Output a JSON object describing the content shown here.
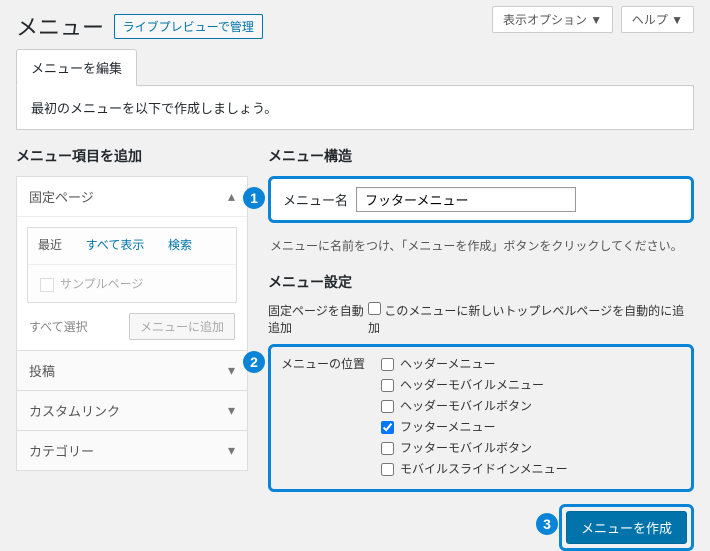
{
  "top": {
    "display_options": "表示オプション ▼",
    "help": "ヘルプ ▼"
  },
  "page": {
    "title": "メニュー",
    "live_preview": "ライブプレビューで管理"
  },
  "tab": {
    "edit": "メニューを編集"
  },
  "notice": "最初のメニューを以下で作成しましょう。",
  "left": {
    "heading": "メニュー項目を追加",
    "pages": {
      "title": "固定ページ",
      "tabs": {
        "recent": "最近",
        "all": "すべて表示",
        "search": "検索"
      },
      "item": "サンプルページ",
      "select_all": "すべて選択",
      "add": "メニューに追加"
    },
    "posts": "投稿",
    "custom": "カスタムリンク",
    "category": "カテゴリー"
  },
  "right": {
    "heading": "メニュー構造",
    "menu_name_label": "メニュー名",
    "menu_name_value": "フッターメニュー",
    "help": "メニューに名前をつけ、「メニューを作成」ボタンをクリックしてください。",
    "settings_heading": "メニュー設定",
    "auto_add_label": "固定ページを自動追加",
    "auto_add_text": "このメニューに新しいトップレベルページを自動的に追加",
    "location_label": "メニューの位置",
    "locations": [
      {
        "label": "ヘッダーメニュー",
        "checked": false
      },
      {
        "label": "ヘッダーモバイルメニュー",
        "checked": false
      },
      {
        "label": "ヘッダーモバイルボタン",
        "checked": false
      },
      {
        "label": "フッターメニュー",
        "checked": true
      },
      {
        "label": "フッターモバイルボタン",
        "checked": false
      },
      {
        "label": "モバイルスライドインメニュー",
        "checked": false
      }
    ],
    "create": "メニューを作成"
  },
  "badges": {
    "one": "1",
    "two": "2",
    "three": "3"
  }
}
